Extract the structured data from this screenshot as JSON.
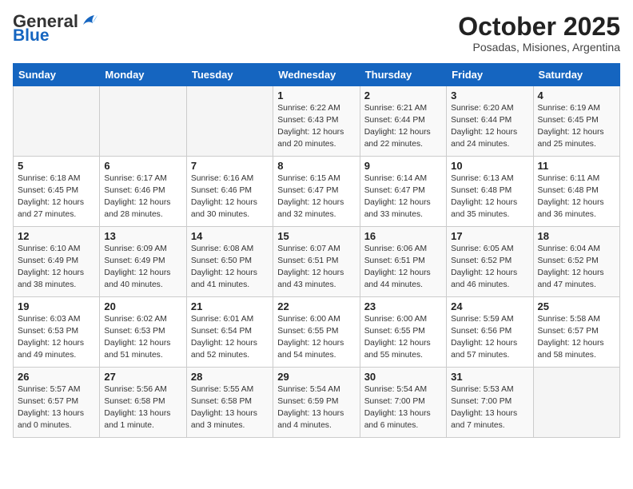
{
  "header": {
    "logo_general": "General",
    "logo_blue": "Blue",
    "title": "October 2025",
    "subtitle": "Posadas, Misiones, Argentina"
  },
  "weekdays": [
    "Sunday",
    "Monday",
    "Tuesday",
    "Wednesday",
    "Thursday",
    "Friday",
    "Saturday"
  ],
  "weeks": [
    [
      {
        "day": "",
        "info": ""
      },
      {
        "day": "",
        "info": ""
      },
      {
        "day": "",
        "info": ""
      },
      {
        "day": "1",
        "info": "Sunrise: 6:22 AM\nSunset: 6:43 PM\nDaylight: 12 hours\nand 20 minutes."
      },
      {
        "day": "2",
        "info": "Sunrise: 6:21 AM\nSunset: 6:44 PM\nDaylight: 12 hours\nand 22 minutes."
      },
      {
        "day": "3",
        "info": "Sunrise: 6:20 AM\nSunset: 6:44 PM\nDaylight: 12 hours\nand 24 minutes."
      },
      {
        "day": "4",
        "info": "Sunrise: 6:19 AM\nSunset: 6:45 PM\nDaylight: 12 hours\nand 25 minutes."
      }
    ],
    [
      {
        "day": "5",
        "info": "Sunrise: 6:18 AM\nSunset: 6:45 PM\nDaylight: 12 hours\nand 27 minutes."
      },
      {
        "day": "6",
        "info": "Sunrise: 6:17 AM\nSunset: 6:46 PM\nDaylight: 12 hours\nand 28 minutes."
      },
      {
        "day": "7",
        "info": "Sunrise: 6:16 AM\nSunset: 6:46 PM\nDaylight: 12 hours\nand 30 minutes."
      },
      {
        "day": "8",
        "info": "Sunrise: 6:15 AM\nSunset: 6:47 PM\nDaylight: 12 hours\nand 32 minutes."
      },
      {
        "day": "9",
        "info": "Sunrise: 6:14 AM\nSunset: 6:47 PM\nDaylight: 12 hours\nand 33 minutes."
      },
      {
        "day": "10",
        "info": "Sunrise: 6:13 AM\nSunset: 6:48 PM\nDaylight: 12 hours\nand 35 minutes."
      },
      {
        "day": "11",
        "info": "Sunrise: 6:11 AM\nSunset: 6:48 PM\nDaylight: 12 hours\nand 36 minutes."
      }
    ],
    [
      {
        "day": "12",
        "info": "Sunrise: 6:10 AM\nSunset: 6:49 PM\nDaylight: 12 hours\nand 38 minutes."
      },
      {
        "day": "13",
        "info": "Sunrise: 6:09 AM\nSunset: 6:49 PM\nDaylight: 12 hours\nand 40 minutes."
      },
      {
        "day": "14",
        "info": "Sunrise: 6:08 AM\nSunset: 6:50 PM\nDaylight: 12 hours\nand 41 minutes."
      },
      {
        "day": "15",
        "info": "Sunrise: 6:07 AM\nSunset: 6:51 PM\nDaylight: 12 hours\nand 43 minutes."
      },
      {
        "day": "16",
        "info": "Sunrise: 6:06 AM\nSunset: 6:51 PM\nDaylight: 12 hours\nand 44 minutes."
      },
      {
        "day": "17",
        "info": "Sunrise: 6:05 AM\nSunset: 6:52 PM\nDaylight: 12 hours\nand 46 minutes."
      },
      {
        "day": "18",
        "info": "Sunrise: 6:04 AM\nSunset: 6:52 PM\nDaylight: 12 hours\nand 47 minutes."
      }
    ],
    [
      {
        "day": "19",
        "info": "Sunrise: 6:03 AM\nSunset: 6:53 PM\nDaylight: 12 hours\nand 49 minutes."
      },
      {
        "day": "20",
        "info": "Sunrise: 6:02 AM\nSunset: 6:53 PM\nDaylight: 12 hours\nand 51 minutes."
      },
      {
        "day": "21",
        "info": "Sunrise: 6:01 AM\nSunset: 6:54 PM\nDaylight: 12 hours\nand 52 minutes."
      },
      {
        "day": "22",
        "info": "Sunrise: 6:00 AM\nSunset: 6:55 PM\nDaylight: 12 hours\nand 54 minutes."
      },
      {
        "day": "23",
        "info": "Sunrise: 6:00 AM\nSunset: 6:55 PM\nDaylight: 12 hours\nand 55 minutes."
      },
      {
        "day": "24",
        "info": "Sunrise: 5:59 AM\nSunset: 6:56 PM\nDaylight: 12 hours\nand 57 minutes."
      },
      {
        "day": "25",
        "info": "Sunrise: 5:58 AM\nSunset: 6:57 PM\nDaylight: 12 hours\nand 58 minutes."
      }
    ],
    [
      {
        "day": "26",
        "info": "Sunrise: 5:57 AM\nSunset: 6:57 PM\nDaylight: 13 hours\nand 0 minutes."
      },
      {
        "day": "27",
        "info": "Sunrise: 5:56 AM\nSunset: 6:58 PM\nDaylight: 13 hours\nand 1 minute."
      },
      {
        "day": "28",
        "info": "Sunrise: 5:55 AM\nSunset: 6:58 PM\nDaylight: 13 hours\nand 3 minutes."
      },
      {
        "day": "29",
        "info": "Sunrise: 5:54 AM\nSunset: 6:59 PM\nDaylight: 13 hours\nand 4 minutes."
      },
      {
        "day": "30",
        "info": "Sunrise: 5:54 AM\nSunset: 7:00 PM\nDaylight: 13 hours\nand 6 minutes."
      },
      {
        "day": "31",
        "info": "Sunrise: 5:53 AM\nSunset: 7:00 PM\nDaylight: 13 hours\nand 7 minutes."
      },
      {
        "day": "",
        "info": ""
      }
    ]
  ]
}
